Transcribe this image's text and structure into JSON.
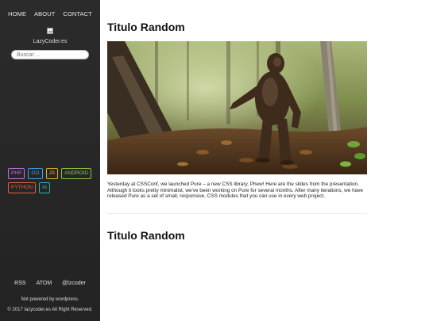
{
  "nav": {
    "home": "HOME",
    "about": "ABOUT",
    "contact": "CONTACT"
  },
  "site_name": "LazyCoder.es",
  "search": {
    "placeholder": "Buscar ..."
  },
  "tags": [
    {
      "label": "PHP",
      "color": "#c070e0"
    },
    {
      "label": "GO",
      "color": "#3aa0e0"
    },
    {
      "label": "JS",
      "color": "#e0b020"
    },
    {
      "label": "ANDROID",
      "color": "#8cc63f"
    },
    {
      "label": "PYTHON",
      "color": "#e06040"
    },
    {
      "label": "IA",
      "color": "#30b0b0"
    }
  ],
  "footer": {
    "rss": "RSS",
    "atom": "ATOM",
    "twitter": "@lzcoder",
    "powered": "Not powered by wordpress.",
    "copyright": "© 2017 lazycoder.es All Right Reserved."
  },
  "posts": [
    {
      "title": "Titulo Random",
      "excerpt": "Yesterday at CSSConf, we launched Pure – a new CSS library. Phew! Here are the slides from the presentation. Although it looks pretty minimalist, we've been working on Pure for several months. After many iterations, we have released Pure as a set of small, responsive, CSS modules that you can use in every web project."
    },
    {
      "title": "Titulo Random"
    }
  ]
}
